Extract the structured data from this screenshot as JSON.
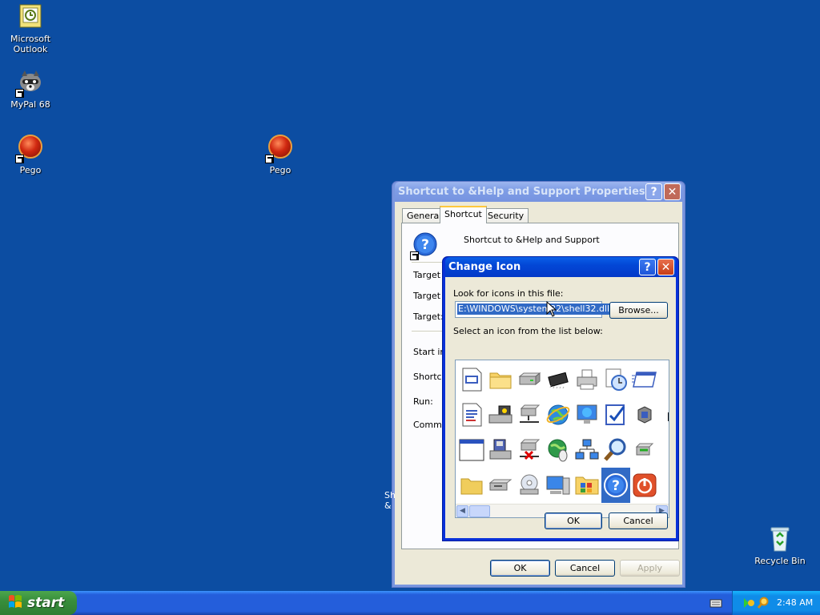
{
  "desktop": {
    "icons": [
      {
        "label_line1": "Microsoft",
        "label_line2": "Outlook"
      },
      {
        "label_line1": "MyPal 68",
        "label_line2": ""
      },
      {
        "label_line1": "Pego",
        "label_line2": ""
      },
      {
        "label_line1": "Pego",
        "label_line2": ""
      },
      {
        "label_line1": "Recycle Bin",
        "label_line2": ""
      }
    ]
  },
  "properties_dialog": {
    "title": "Shortcut to &Help and Support Properties",
    "tabs": [
      "General",
      "Shortcut",
      "Security"
    ],
    "selected_tab": "Shortcut",
    "shortcut_name": "Shortcut to &Help and Support",
    "fields": [
      "Target ty",
      "Target lo",
      "Target:",
      "Start in:",
      "Shortcu",
      "Run:",
      "Commen"
    ],
    "buttons": {
      "ok": "OK",
      "cancel": "Cancel",
      "apply": "Apply"
    }
  },
  "change_icon_dialog": {
    "title": "Change Icon",
    "look_for_label": "Look for icons in this file:",
    "file_path": "E:\\WINDOWS\\system32\\shell32.dll",
    "browse_label": "Browse...",
    "select_label": "Select an icon from the list below:",
    "buttons": {
      "ok": "OK",
      "cancel": "Cancel"
    }
  },
  "taskbar": {
    "start_label": "start",
    "clock": "2:48 AM"
  },
  "colors": {
    "desktop": "#0c4da2",
    "selection": "#316ac5",
    "title_active": "#0347d6",
    "start_green": "#388e3c"
  }
}
